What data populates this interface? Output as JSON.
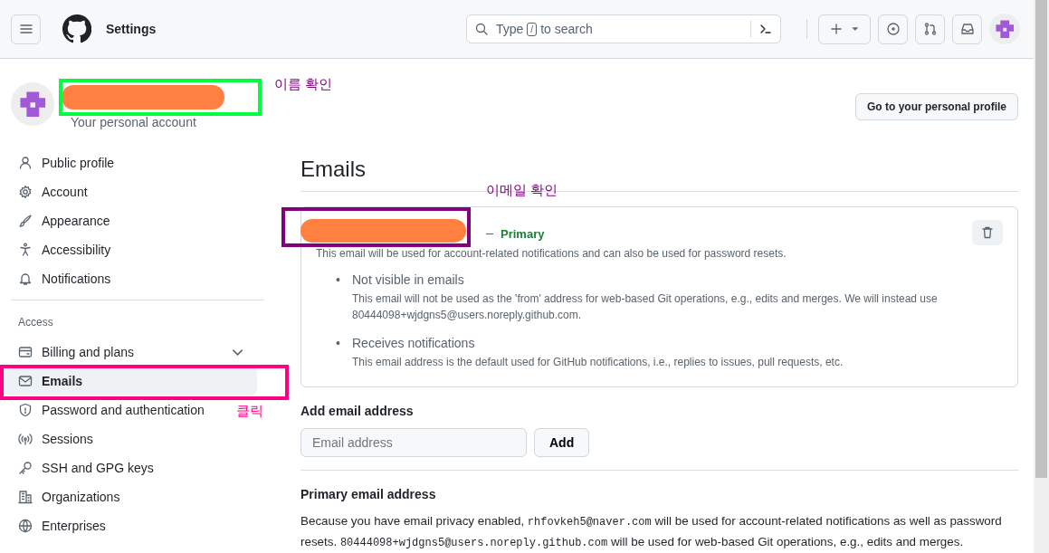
{
  "header": {
    "title": "Settings",
    "search_placeholder_parts": [
      "Type",
      "/",
      "to search"
    ]
  },
  "profile": {
    "caption": "Your personal account",
    "button": "Go to your personal profile"
  },
  "sidebar": {
    "items": [
      {
        "label": "Public profile",
        "selected": false
      },
      {
        "label": "Account",
        "selected": false
      },
      {
        "label": "Appearance",
        "selected": false
      },
      {
        "label": "Accessibility",
        "selected": false
      },
      {
        "label": "Notifications",
        "selected": false
      }
    ],
    "section": "Access",
    "access_items": [
      {
        "label": "Billing and plans",
        "selected": false,
        "expandable": true
      },
      {
        "label": "Emails",
        "selected": true,
        "expandable": false
      },
      {
        "label": "Password and authentication",
        "selected": false,
        "expandable": false
      },
      {
        "label": "Sessions",
        "selected": false,
        "expandable": false
      },
      {
        "label": "SSH and GPG keys",
        "selected": false,
        "expandable": false
      },
      {
        "label": "Organizations",
        "selected": false,
        "expandable": false
      },
      {
        "label": "Enterprises",
        "selected": false,
        "expandable": false
      }
    ]
  },
  "main": {
    "title": "Emails",
    "email_card": {
      "badge": "Primary",
      "note": "This email will be used for account-related notifications and can also be used for password resets.",
      "points": [
        {
          "bullet": "•",
          "title": "Not visible in emails",
          "text": "This email will not be used as the 'from' address for web-based Git operations, e.g., edits and merges. We will instead use 80444098+wjdgns5@users.noreply.github.com."
        },
        {
          "bullet": "•",
          "title": "Receives notifications",
          "text": "This email address is the default used for GitHub notifications, i.e., replies to issues, pull requests, etc."
        }
      ]
    },
    "add": {
      "heading": "Add email address",
      "placeholder": "Email address",
      "button": "Add"
    },
    "primary": {
      "heading": "Primary email address",
      "segments": [
        {
          "kind": "text",
          "text": "Because you have email privacy enabled, "
        },
        {
          "kind": "code",
          "text": "rhfovkeh5@naver.com"
        },
        {
          "kind": "text",
          "text": " will be used for account-related notifications as well as password resets. "
        },
        {
          "kind": "code",
          "text": "80444098+wjdgns5@users.noreply.github.com"
        },
        {
          "kind": "text",
          "text": " will be used for web-based Git operations, e.g., edits and merges."
        }
      ]
    }
  },
  "annotations": [
    {
      "kind": "redaction",
      "color": "#ff8040"
    },
    {
      "kind": "box",
      "color": "#00ff40"
    },
    {
      "kind": "label",
      "text": "이름 확인",
      "color": "#800080"
    },
    {
      "kind": "redaction",
      "color": "#ff8040"
    },
    {
      "kind": "box",
      "color": "#800080"
    },
    {
      "kind": "label",
      "text": "이메일 확인",
      "color": "#800080"
    },
    {
      "kind": "box",
      "color": "#ff0080"
    },
    {
      "kind": "label",
      "text": "클릭",
      "color": "#ff0080"
    }
  ]
}
